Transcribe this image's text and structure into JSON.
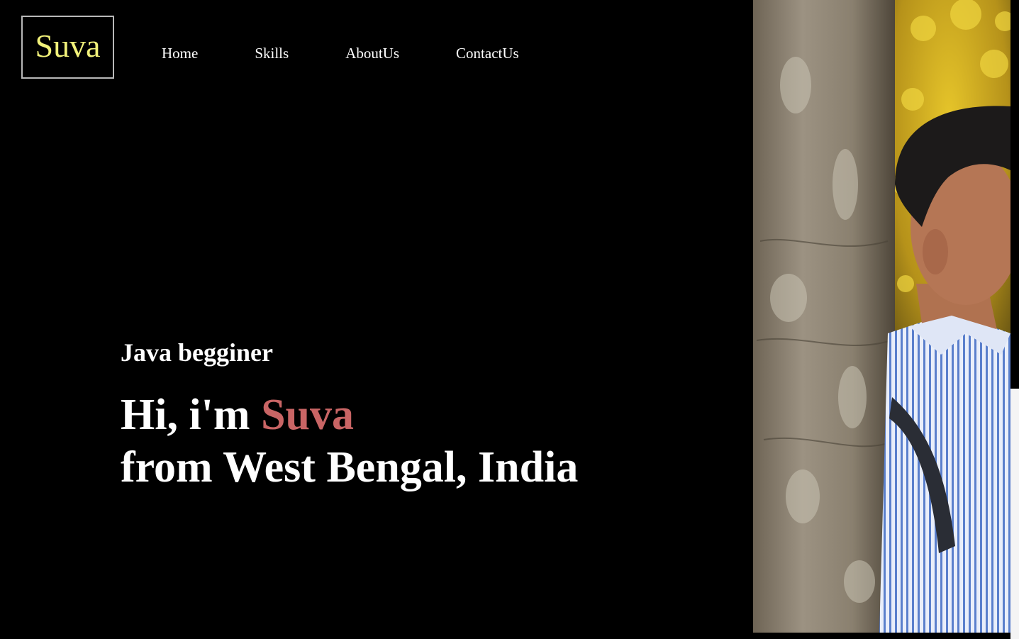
{
  "logo": {
    "text": "Suva"
  },
  "nav": {
    "items": [
      {
        "label": "Home"
      },
      {
        "label": "Skills"
      },
      {
        "label": "AboutUs"
      },
      {
        "label": "ContactUs"
      }
    ]
  },
  "hero": {
    "subtitle": "Java begginer",
    "greeting": "Hi, i'm ",
    "name": "Suva",
    "location": "from West Bengal, India"
  },
  "colors": {
    "background": "#000000",
    "logo_text": "#f2f27a",
    "accent_name": "#c96565",
    "text": "#ffffff"
  }
}
